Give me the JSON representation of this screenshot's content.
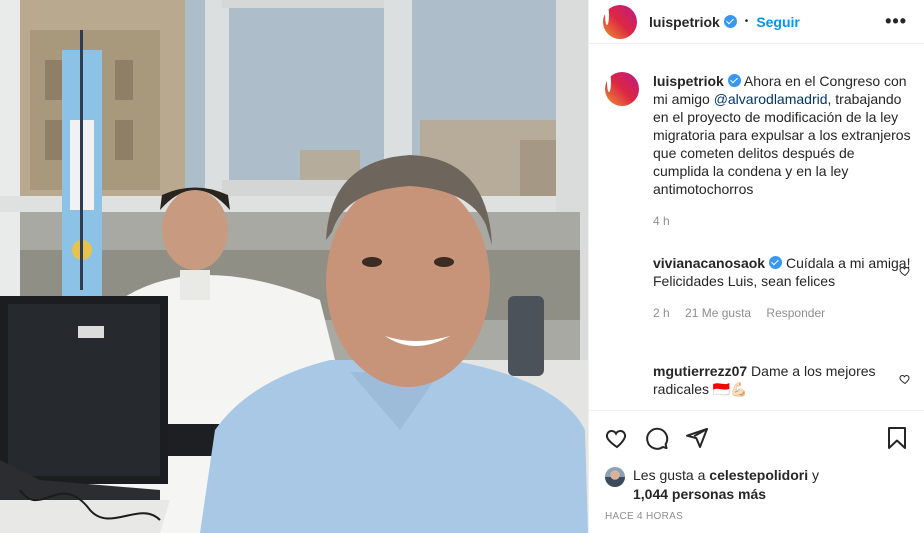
{
  "post": {
    "username": "luispetriok",
    "dot": "•",
    "follow_label": "Seguir",
    "more_label": "•••",
    "caption_parts": {
      "before_mention": "Ahora en el Congreso con mi amigo ",
      "mention": "@alvarodlamadrid",
      "after_mention": ", trabajando en el proyecto de modificación de la ley migratoria para expulsar a los extranjeros que cometen delitos después de cumplida la condena y en la ley antimotochorros"
    },
    "caption_time": "4 h"
  },
  "comments": [
    {
      "username": "vivianacanosaok",
      "text": "Cuídala a mi amiga!",
      "text2": "Felicidades Luis, sean felices",
      "time": "2 h",
      "likes": "21 Me gusta",
      "reply": "Responder"
    },
    {
      "username": "mgutierrezz07",
      "text": "Dame a los mejores radicales 🇮🇩💪🏻"
    }
  ],
  "likes": {
    "prefix": "Les gusta a ",
    "user": "celestepolidori",
    "suffix": " y",
    "others": "1,044 personas más"
  },
  "timestamp": "HACE 4 HORAS",
  "icons": {
    "like": "heart-icon",
    "comment": "comment-icon",
    "share": "share-icon",
    "save": "bookmark-icon",
    "verified": "verified-badge-icon"
  },
  "colors": {
    "accent": "#0095f6",
    "verified": "#3897f0",
    "mention": "#00376b",
    "muted": "#8e8e8e"
  }
}
